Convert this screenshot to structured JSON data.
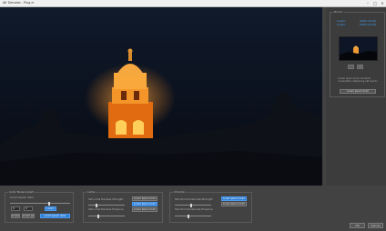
{
  "window": {
    "title": "Afr Denoise - Plug-in",
    "min_glyph": "–",
    "max_glyph": "□",
    "close_glyph": "×"
  },
  "zoom_panel": {
    "label": "Zoom",
    "info_left_1": "Lorem",
    "info_right_1": "000% 00 00",
    "info_left_2": "Lorem",
    "info_right_2": "000% 00 00",
    "zoom_in_label": "+",
    "zoom_out_label": "-",
    "note": "Lorem ipsum dolor sit amet consectetur adipiscing elit sed do",
    "reset_button": "Lorem ipsum dolor"
  },
  "color_group": {
    "label": "Color Noise Lorem",
    "label1": "Lorem ipsum dolor",
    "input1": "0",
    "input2": "0",
    "button1": "Lorem",
    "button2": "Lorem",
    "button3": "Lorem ipsum",
    "blue_button": "Lorem ipsum dolor"
  },
  "luma_group": {
    "label": "Luma",
    "strength_label": "Set Luma Denoise Strength",
    "preserve_label": "Set Luma Denoise Preserve",
    "btn_top": "Lorem ipsum dolor",
    "btn_mid": "Lorem ipsum dolor",
    "btn_bottom": "Lorem ipsum dolor"
  },
  "chroma_group": {
    "label": "Chroma",
    "strength_label": "Set Chroma Denoise Strength",
    "preserve_label": "Set Chroma Denoise Preserve",
    "btn_top": "Lorem ipsum dolor",
    "btn_bottom": "Lorem ipsum dolor"
  },
  "footer": {
    "ok": "OK",
    "cancel": "Cancel"
  }
}
